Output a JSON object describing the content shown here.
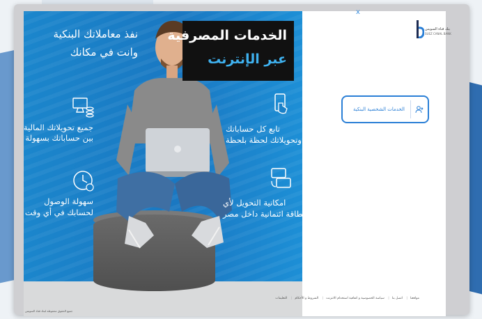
{
  "banner": {
    "headline_line1": "الخدمات المصرفية",
    "headline_line2": "عبر الإنترنت",
    "tagline_line1": "نفذ معاملاتك البنكية",
    "tagline_line2": "وانت في مكانك",
    "features": {
      "transfers_line1": "جميع تحويلاتك المالية",
      "transfers_line2": "بين حساباتك بسهولة",
      "access_line1": "سهولة الوصول",
      "access_line2": "لحسابك في أي وقت",
      "track_line1": "تابع كل حساباتك",
      "track_line2": "وتحويلاتك لحظة بلحظة",
      "card_line1": "امكانية التحويل لأي",
      "card_line2": "بطاقة ائتمانية داخل مصر"
    },
    "colors": {
      "accent": "#1a80c8",
      "headline_accent": "#3fb2f0"
    }
  },
  "panel": {
    "close_label": "x",
    "logo_text": "بنك قناة السويس",
    "logo_sub": "SUEZ CANAL BANK",
    "login_button_label": "الخدمات الشخصية البنكية",
    "footer_links": [
      "مواقعنا",
      "اتصل بنا",
      "سياسة الخصوصية و اتفاقية استخدام الانترنت",
      "الشروط و الأحكام",
      "التعليمات"
    ],
    "copyright": "جميع الحقوق محفوظة لبنك قناة السويس"
  },
  "icons": [
    "monitor-coins-icon",
    "clock-icon",
    "phone-touch-icon",
    "card-transfer-icon",
    "login-person-icon"
  ]
}
